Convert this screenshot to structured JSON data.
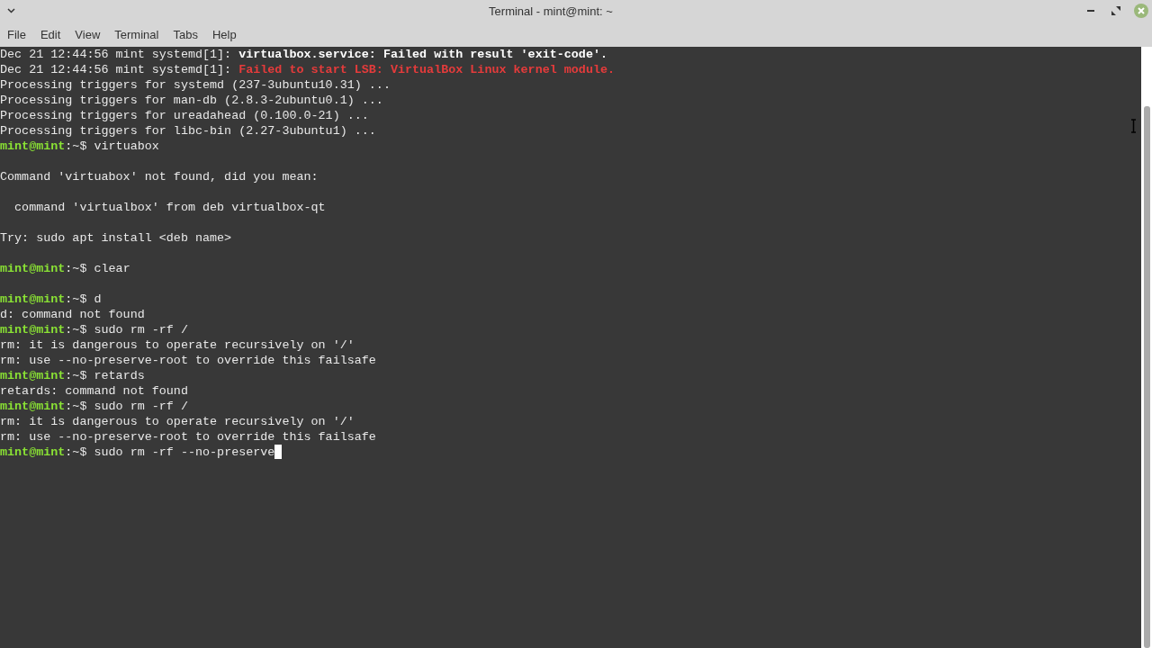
{
  "window": {
    "title": "Terminal - mint@mint: ~"
  },
  "menu": [
    "File",
    "Edit",
    "View",
    "Terminal",
    "Tabs",
    "Help"
  ],
  "lines": [
    {
      "kind": "log",
      "prefix": "Dec 21 12:44:56 mint systemd[1]: ",
      "message": "virtualbox.service: Failed with result 'exit-code'.",
      "error": false
    },
    {
      "kind": "log",
      "prefix": "Dec 21 12:44:56 mint systemd[1]: ",
      "message": "Failed to start LSB: VirtualBox Linux kernel module.",
      "error": true
    },
    {
      "kind": "output",
      "text": "Processing triggers for systemd (237-3ubuntu10.31) ..."
    },
    {
      "kind": "output",
      "text": "Processing triggers for man-db (2.8.3-2ubuntu0.1) ..."
    },
    {
      "kind": "output",
      "text": "Processing triggers for ureadahead (0.100.0-21) ..."
    },
    {
      "kind": "output",
      "text": "Processing triggers for libc-bin (2.27-3ubuntu1) ..."
    },
    {
      "kind": "prompt",
      "user": "mint@mint",
      "path": ":~$ ",
      "command": "virtuabox"
    },
    {
      "kind": "blank"
    },
    {
      "kind": "output",
      "text": "Command 'virtuabox' not found, did you mean:"
    },
    {
      "kind": "blank"
    },
    {
      "kind": "output",
      "text": "  command 'virtualbox' from deb virtualbox-qt"
    },
    {
      "kind": "blank"
    },
    {
      "kind": "output",
      "text": "Try: sudo apt install <deb name>"
    },
    {
      "kind": "blank"
    },
    {
      "kind": "prompt",
      "user": "mint@mint",
      "path": ":~$ ",
      "command": "clear"
    },
    {
      "kind": "blank"
    },
    {
      "kind": "prompt",
      "user": "mint@mint",
      "path": ":~$ ",
      "command": "d"
    },
    {
      "kind": "output",
      "text": "d: command not found"
    },
    {
      "kind": "prompt",
      "user": "mint@mint",
      "path": ":~$ ",
      "command": "sudo rm -rf /"
    },
    {
      "kind": "output",
      "text": "rm: it is dangerous to operate recursively on '/'"
    },
    {
      "kind": "output",
      "text": "rm: use --no-preserve-root to override this failsafe"
    },
    {
      "kind": "prompt",
      "user": "mint@mint",
      "path": ":~$ ",
      "command": "retards"
    },
    {
      "kind": "output",
      "text": "retards: command not found"
    },
    {
      "kind": "prompt",
      "user": "mint@mint",
      "path": ":~$ ",
      "command": "sudo rm -rf /"
    },
    {
      "kind": "output",
      "text": "rm: it is dangerous to operate recursively on '/'"
    },
    {
      "kind": "output",
      "text": "rm: use --no-preserve-root to override this failsafe"
    },
    {
      "kind": "prompt",
      "user": "mint@mint",
      "path": ":~$ ",
      "command": "sudo rm -rf --no-preserve",
      "cursor": true
    }
  ]
}
